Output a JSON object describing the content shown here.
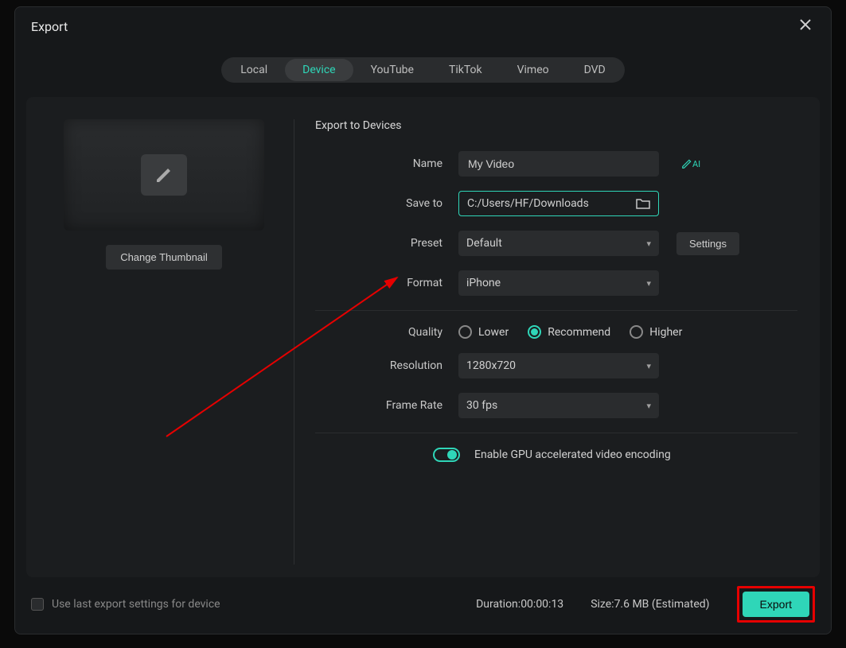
{
  "window": {
    "title": "Export"
  },
  "tabs": {
    "local": "Local",
    "device": "Device",
    "youtube": "YouTube",
    "tiktok": "TikTok",
    "vimeo": "Vimeo",
    "dvd": "DVD"
  },
  "thumbnail": {
    "change_label": "Change Thumbnail"
  },
  "form": {
    "section_title": "Export to Devices",
    "name_label": "Name",
    "name_value": "My Video",
    "saveto_label": "Save to",
    "saveto_value": "C:/Users/HF/Downloads",
    "preset_label": "Preset",
    "preset_value": "Default",
    "settings_label": "Settings",
    "format_label": "Format",
    "format_value": "iPhone",
    "quality_label": "Quality",
    "quality_lower": "Lower",
    "quality_recommend": "Recommend",
    "quality_higher": "Higher",
    "resolution_label": "Resolution",
    "resolution_value": "1280x720",
    "framerate_label": "Frame Rate",
    "framerate_value": "30 fps",
    "gpu_label": "Enable GPU accelerated video encoding",
    "ai_text": "AI"
  },
  "footer": {
    "use_last_label": "Use last export settings for device",
    "duration_label": "Duration:",
    "duration_value": "00:00:13",
    "size_label": "Size:",
    "size_value": "7.6 MB",
    "size_suffix": "(Estimated)",
    "export_label": "Export"
  }
}
